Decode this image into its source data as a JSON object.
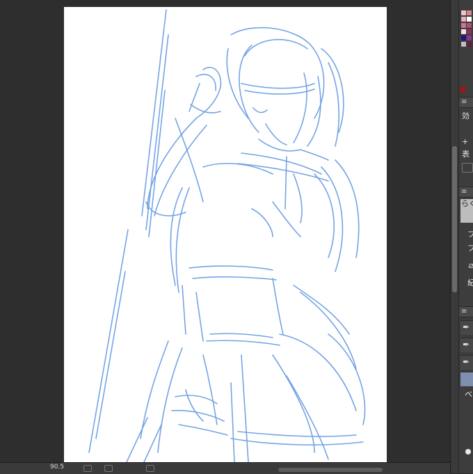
{
  "app": {
    "accent_color": "#7d8eae",
    "background_color": "#2e2e2e"
  },
  "canvas": {
    "sketch_color": "#5b93e0",
    "paper_color": "#ffffff"
  },
  "color_palette": {
    "swatches": [
      "#f0c8c8",
      "#d08898",
      "#e8b0b8",
      "#ffffff",
      "#c87890",
      "#b05070",
      "#f8e0e0",
      "#903060",
      "#1a1a80",
      "#8a3a8a",
      "#c0c0c0",
      "#602040"
    ]
  },
  "panels": {
    "panel_menu_icon": "≡",
    "sub_tool_menu_icon": "≡",
    "layer_menu_icon": "≡",
    "brush_menu_icon": "≡",
    "effect_label": "効",
    "add_icon": "+",
    "display_label": "表",
    "layer_name_partial": "らくが",
    "row_labels": [
      "フ",
      "フ",
      "ㄹ",
      "紀"
    ],
    "brush_icons": [
      "pen-nib-icon",
      "pen-nib-icon",
      "pen-nib-icon"
    ]
  },
  "status": {
    "zoom_text": "90.5"
  }
}
